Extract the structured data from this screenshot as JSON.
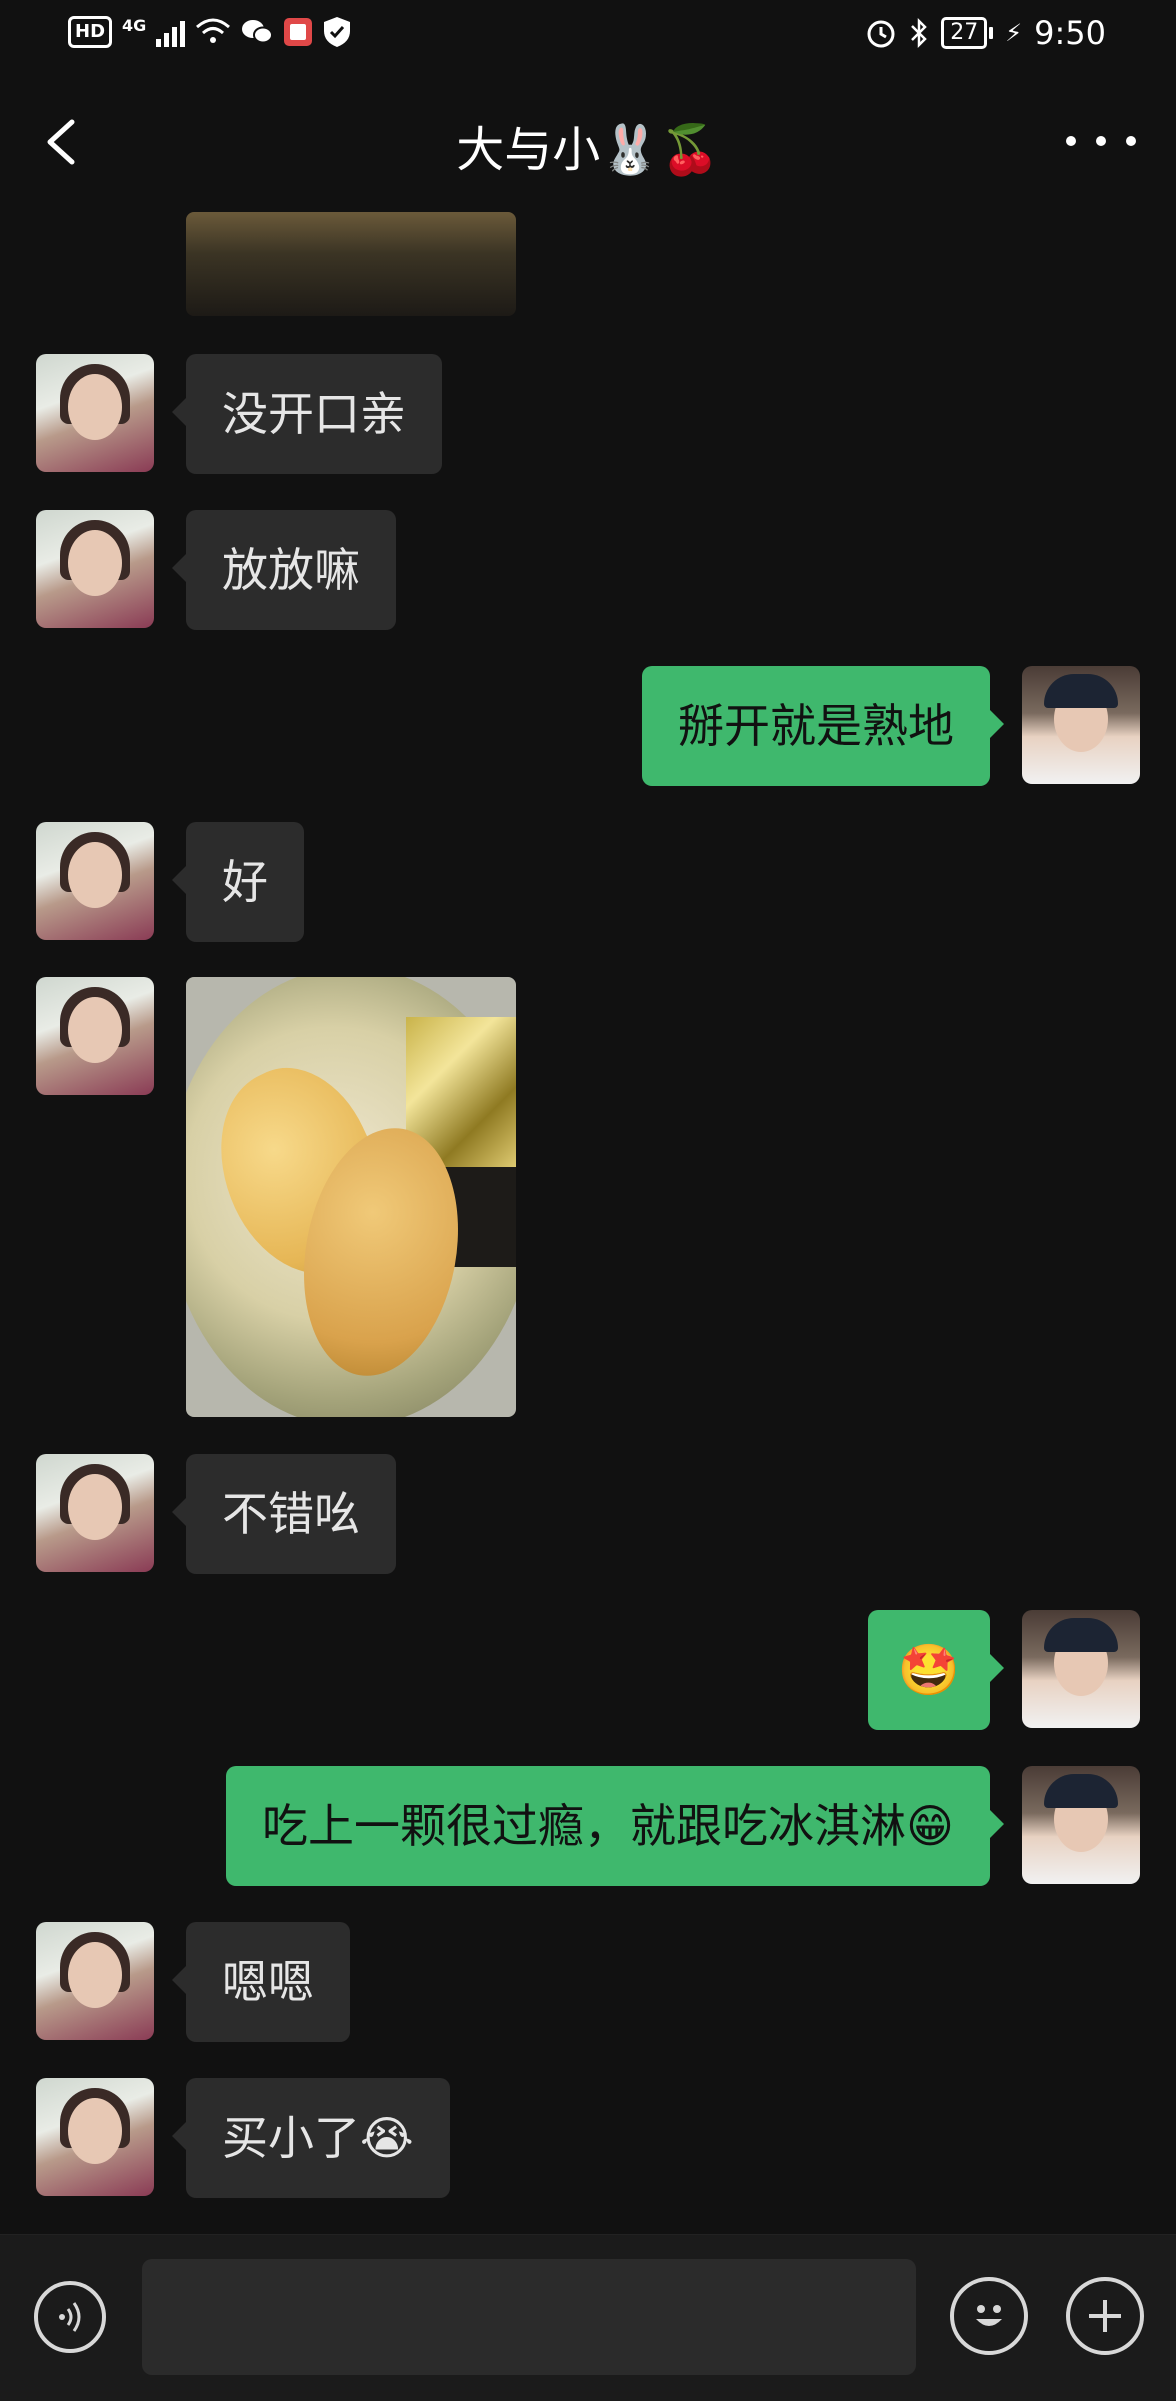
{
  "status_bar": {
    "hd": "HD",
    "network": "4G",
    "battery": "27",
    "time": "9:50"
  },
  "header": {
    "title": "大与小🐰🍒",
    "back_icon": "chevron-left-icon",
    "more_icon": "more-dots-icon"
  },
  "messages": [
    {
      "side": "in",
      "type": "image",
      "desc_icon": "photo"
    },
    {
      "side": "in",
      "type": "text",
      "text": "没开口亲"
    },
    {
      "side": "in",
      "type": "text",
      "text": "放放嘛"
    },
    {
      "side": "out",
      "type": "text",
      "text": "掰开就是熟地"
    },
    {
      "side": "in",
      "type": "text",
      "text": "好"
    },
    {
      "side": "in",
      "type": "image",
      "desc_icon": "photo"
    },
    {
      "side": "in",
      "type": "text",
      "text": "不错吆"
    },
    {
      "side": "out",
      "type": "text",
      "text": "🤩"
    },
    {
      "side": "out",
      "type": "text",
      "text": "吃上一颗很过瘾，就跟吃冰淇淋😁"
    },
    {
      "side": "in",
      "type": "text",
      "text": "嗯嗯"
    },
    {
      "side": "in",
      "type": "text",
      "text": "买小了😭"
    }
  ],
  "input_bar": {
    "voice_icon": "voice-icon",
    "emoji_icon": "emoji-icon",
    "plus_icon": "plus-icon",
    "placeholder": ""
  },
  "colors": {
    "background": "#111111",
    "incoming_bubble": "#2c2c2c",
    "outgoing_bubble": "#3fb86d"
  }
}
